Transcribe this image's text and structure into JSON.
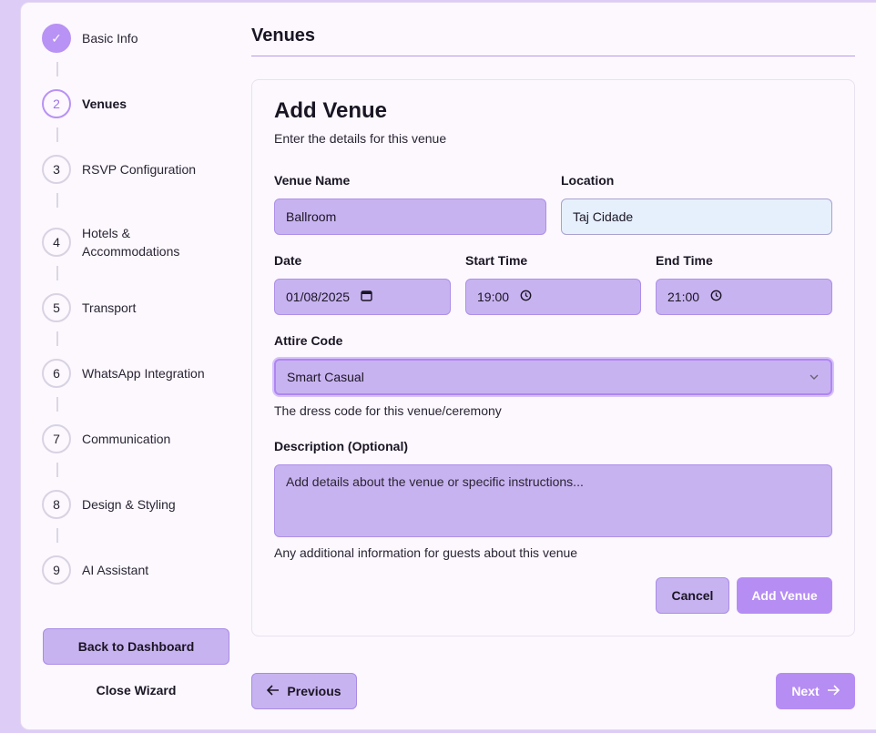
{
  "sidebar": {
    "steps": [
      {
        "number": "✓",
        "label": "Basic Info"
      },
      {
        "number": "2",
        "label": "Venues"
      },
      {
        "number": "3",
        "label": "RSVP Configuration"
      },
      {
        "number": "4",
        "label": "Hotels & Accommodations"
      },
      {
        "number": "5",
        "label": "Transport"
      },
      {
        "number": "6",
        "label": "WhatsApp Integration"
      },
      {
        "number": "7",
        "label": "Communication"
      },
      {
        "number": "8",
        "label": "Design & Styling"
      },
      {
        "number": "9",
        "label": "AI Assistant"
      }
    ],
    "back_label": "Back to Dashboard",
    "close_label": "Close Wizard"
  },
  "main": {
    "title": "Venues",
    "card": {
      "title": "Add Venue",
      "subtitle": "Enter the details for this venue",
      "venue_name_label": "Venue Name",
      "venue_name_value": "Ballroom",
      "location_label": "Location",
      "location_value": "Taj Cidade",
      "date_label": "Date",
      "date_value": "01/08/2025",
      "start_time_label": "Start Time",
      "start_time_value": "19:00",
      "end_time_label": "End Time",
      "end_time_value": "21:00",
      "attire_label": "Attire Code",
      "attire_value": "Smart Casual",
      "attire_help": "The dress code for this venue/ceremony",
      "description_label": "Description (Optional)",
      "description_placeholder": "Add details about the venue or specific instructions...",
      "description_help": "Any additional information for guests about this venue",
      "cancel_label": "Cancel",
      "add_label": "Add Venue"
    },
    "previous_label": "Previous",
    "next_label": "Next"
  },
  "colors": {
    "accent": "#b68df3",
    "field_bg": "#c8b3f1",
    "location_bg": "#e6f0fd",
    "page_bg": "#dcccf6"
  }
}
